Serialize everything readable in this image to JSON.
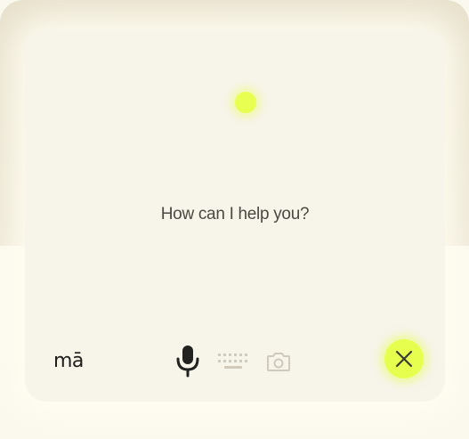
{
  "assistant": {
    "prompt": "How can I help you?",
    "logo": "mā"
  },
  "toolbar": {
    "icons": [
      "microphone-icon",
      "keyboard-icon",
      "camera-icon",
      "close-icon"
    ]
  },
  "colors": {
    "accent": "#e6ff4f",
    "card": "#f7f4ea",
    "text": "#4a4a42",
    "icon_dark": "#222220",
    "icon_muted": "#cfcabb"
  }
}
